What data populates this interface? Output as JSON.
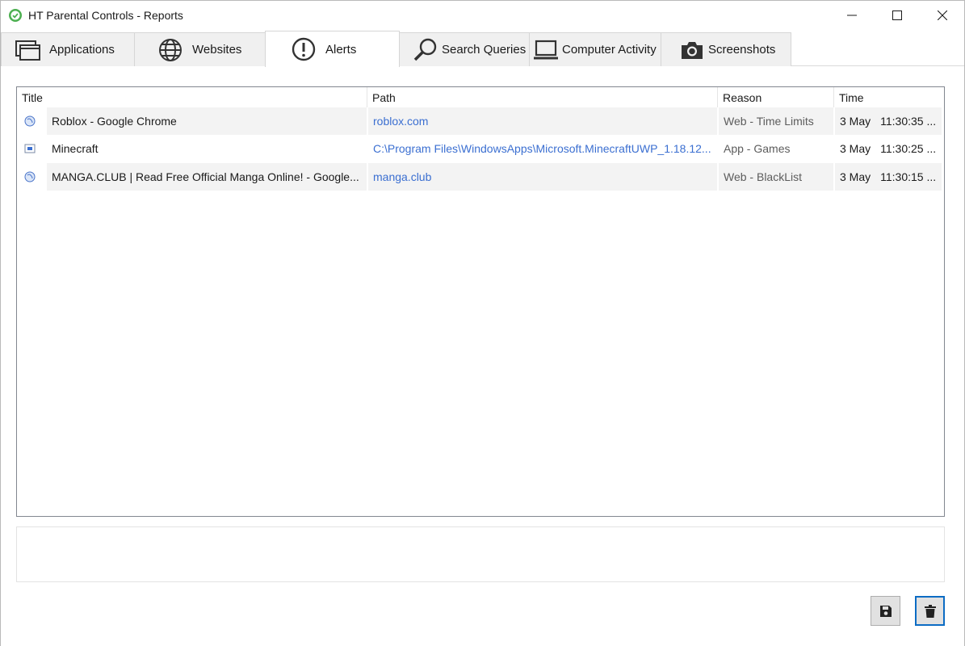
{
  "window": {
    "title": "HT Parental Controls - Reports",
    "icon": "shield-check-icon",
    "accent_color": "#4caf50"
  },
  "tabs": [
    {
      "label": "Applications",
      "icon": "windows-stack-icon",
      "active": false
    },
    {
      "label": "Websites",
      "icon": "globe-icon",
      "active": false
    },
    {
      "label": "Alerts",
      "icon": "exclamation-circle-icon",
      "active": true
    },
    {
      "label": "Search Queries",
      "icon": "search-icon",
      "active": false
    },
    {
      "label": "Computer Activity",
      "icon": "laptop-icon",
      "active": false
    },
    {
      "label": "Screenshots",
      "icon": "camera-icon",
      "active": false
    }
  ],
  "table": {
    "columns": [
      "Title",
      "Path",
      "Reason",
      "Time"
    ],
    "rows": [
      {
        "icon": "web-icon",
        "title": "Roblox - Google Chrome",
        "path": "roblox.com",
        "reason": "Web - Time Limits",
        "date": "3 May",
        "time": "11:30:35 ..."
      },
      {
        "icon": "app-icon",
        "title": "Minecraft",
        "path": "C:\\Program Files\\WindowsApps\\Microsoft.MinecraftUWP_1.18.12...",
        "reason": "App - Games",
        "date": "3 May",
        "time": "11:30:25 ..."
      },
      {
        "icon": "web-icon",
        "title": "MANGA.CLUB | Read Free Official Manga Online! - Google...",
        "path": "manga.club",
        "reason": "Web - BlackList",
        "date": "3 May",
        "time": "11:30:15 ..."
      }
    ]
  },
  "buttons": {
    "save_icon": "floppy-disk-icon",
    "delete_icon": "trash-icon"
  },
  "colors": {
    "link": "#3b6fd1",
    "focus_border": "#0c6cc4"
  }
}
